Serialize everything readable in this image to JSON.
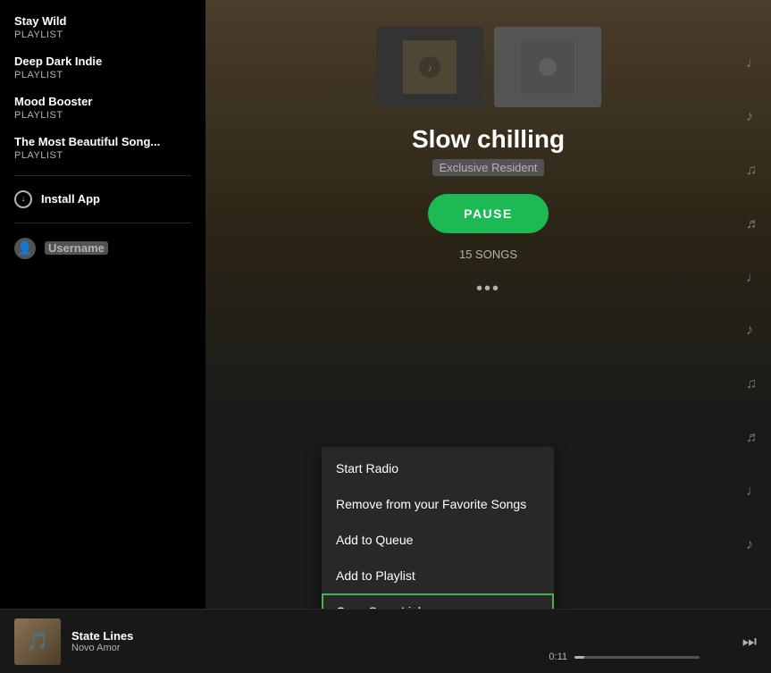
{
  "sidebar": {
    "playlists": [
      {
        "name": "Stay Wild",
        "type": "PLAYLIST"
      },
      {
        "name": "Deep Dark Indie",
        "type": "PLAYLIST"
      },
      {
        "name": "Mood Booster",
        "type": "PLAYLIST"
      },
      {
        "name": "The Most Beautiful Song...",
        "type": "PLAYLIST"
      }
    ],
    "install_app_label": "Install App",
    "username": "Username"
  },
  "main": {
    "playlist_title": "Slow chilling",
    "playlist_subtitle": "Exclusive Resident",
    "pause_button_label": "PAUSE",
    "song_count": "15 SONGS",
    "more_options": "•••"
  },
  "context_menu": {
    "items": [
      {
        "label": "Start Radio",
        "highlighted": false
      },
      {
        "label": "Remove from your Favorite Songs",
        "highlighted": false
      },
      {
        "label": "Add to Queue",
        "highlighted": false
      },
      {
        "label": "Add to Playlist",
        "highlighted": false
      },
      {
        "label": "Copy Song Link",
        "highlighted": true
      }
    ]
  },
  "now_playing": {
    "title": "State Lines",
    "artist": "Novo Amor",
    "time_elapsed": "0:11",
    "progress_percent": 8
  },
  "music_notes": [
    "♩",
    "♪",
    "♫",
    "♬",
    "♩",
    "♪",
    "♫",
    "♬",
    "♩",
    "♪"
  ],
  "colors": {
    "accent_green": "#1db954",
    "highlight_border": "#4caf50"
  }
}
